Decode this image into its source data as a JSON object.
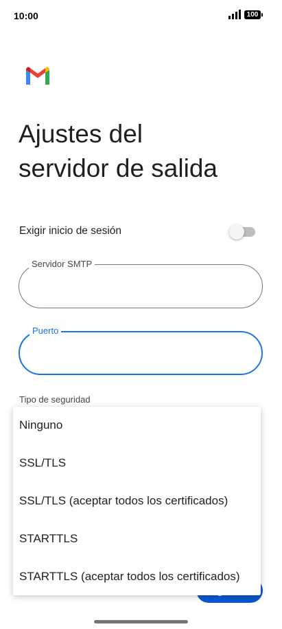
{
  "status_bar": {
    "time": "10:00",
    "battery": "100"
  },
  "app": {
    "logo_icon": "gmail-logo-icon"
  },
  "header": {
    "title_line1": "Ajustes del",
    "title_line2": "servidor de salida"
  },
  "form": {
    "require_signin_label": "Exigir inicio de sesión",
    "require_signin_enabled": false,
    "smtp_label": "Servidor SMTP",
    "smtp_value": "",
    "port_label": "Puerto",
    "port_value": "",
    "security_label": "Tipo de seguridad",
    "next_label": "Siguiente"
  },
  "security_menu": {
    "options": [
      "Ninguno",
      "SSL/TLS",
      "SSL/TLS (aceptar todos los certificados)",
      "STARTTLS",
      "STARTTLS (aceptar todos los certificados)"
    ]
  },
  "colors": {
    "accent": "#1a73e8",
    "button": "#0b57d0",
    "outline": "#747775",
    "text": "#1f1f1f"
  }
}
